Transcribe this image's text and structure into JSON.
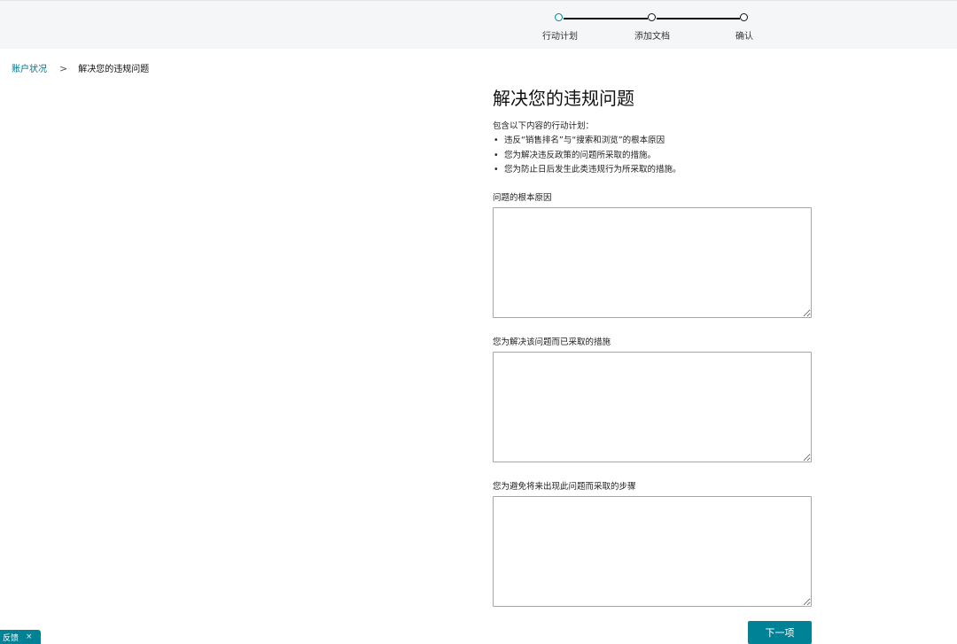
{
  "stepper": {
    "steps": [
      {
        "label": "行动计划",
        "status": "active"
      },
      {
        "label": "添加文档",
        "status": "pending"
      },
      {
        "label": "确认",
        "status": "pending"
      }
    ]
  },
  "breadcrumb": {
    "parent": "账户状况",
    "separator": ">",
    "current": "解决您的违规问题"
  },
  "form": {
    "title": "解决您的违规问题",
    "intro": "包含以下内容的行动计划：",
    "bullets": [
      "违反“销售排名”与“搜索和浏览”的根本原因",
      "您为解决违反政策的问题所采取的措施。",
      "您为防止日后发生此类违规行为所采取的措施。"
    ],
    "fields": [
      {
        "label": "问题的根本原因",
        "value": ""
      },
      {
        "label": "您为解决该问题而已采取的措施",
        "value": ""
      },
      {
        "label": "您为避免将来出现此问题而采取的步骤",
        "value": ""
      }
    ],
    "next_label": "下一项"
  },
  "feedback": {
    "label": "反馈",
    "close_label": "×"
  },
  "colors": {
    "accent": "#008296",
    "link": "#007185",
    "topbar_bg": "#f4f6f7"
  }
}
